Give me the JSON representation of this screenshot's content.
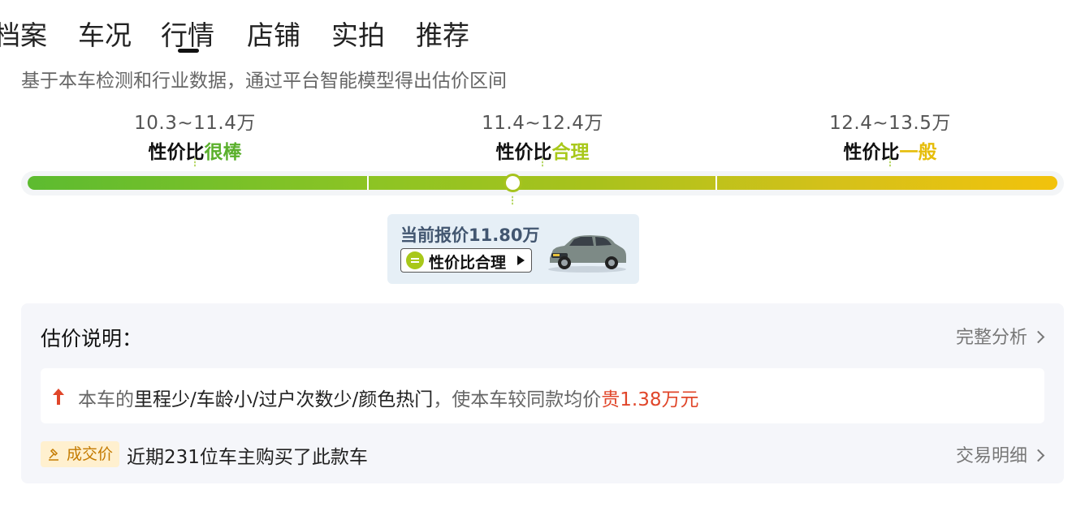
{
  "tabs": [
    "档案",
    "车况",
    "行情",
    "店铺",
    "实拍",
    "推荐"
  ],
  "active_tab": "行情",
  "subtitle": "基于本车检测和行业数据，通过平台智能模型得出估价区间",
  "ranges": [
    {
      "price": "10.3~11.4万",
      "prefix": "性价比",
      "rating": "很棒",
      "color": "#5bb02d"
    },
    {
      "price": "11.4~12.4万",
      "prefix": "性价比",
      "rating": "合理",
      "color": "#a8c81a"
    },
    {
      "price": "12.4~13.5万",
      "prefix": "性价比",
      "rating": "一般",
      "color": "#e6bd0a"
    }
  ],
  "current": {
    "label": "当前报价11.80万",
    "button": "性价比合理",
    "icon": "equal-sign-icon"
  },
  "explanation": {
    "title": "估价说明：",
    "full_analysis": "完整分析",
    "note_prefix": "本车的",
    "note_factors": "里程少/车龄小/过户次数少/颜色热门",
    "note_middle": "，使本车较同款均价",
    "note_result": "贵1.38万元",
    "deal_badge": "成交价",
    "deal_text": "近期231位车主购买了此款车",
    "deal_detail": "交易明细"
  },
  "colors": {
    "accent_green": "#5bb02d",
    "accent_yellowgreen": "#a8c81a",
    "accent_yellow": "#e6bd0a",
    "red": "#e0462a",
    "badge_bg": "#fff0cf"
  }
}
